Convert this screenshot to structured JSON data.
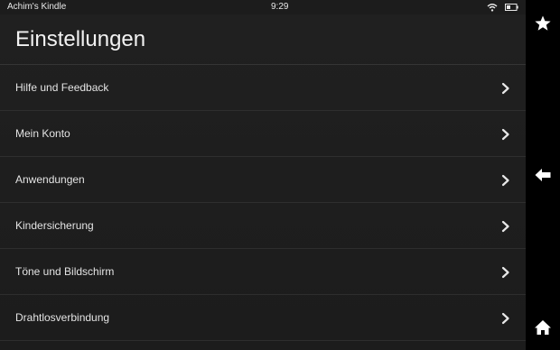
{
  "status_bar": {
    "device_name": "Achim's Kindle",
    "time": "9:29",
    "wifi_icon": "wifi-icon",
    "battery_icon": "battery-icon"
  },
  "page": {
    "title": "Einstellungen"
  },
  "settings": {
    "items": [
      {
        "label": "Hilfe und Feedback",
        "icon": "chevron-right-icon"
      },
      {
        "label": "Mein Konto",
        "icon": "chevron-right-icon"
      },
      {
        "label": "Anwendungen",
        "icon": "chevron-right-icon"
      },
      {
        "label": "Kindersicherung",
        "icon": "chevron-right-icon"
      },
      {
        "label": "Töne und Bildschirm",
        "icon": "chevron-right-icon"
      },
      {
        "label": "Drahtlosverbindung",
        "icon": "chevron-right-icon"
      }
    ]
  },
  "sidebar": {
    "favorites_icon": "star-icon",
    "back_icon": "back-arrow-icon",
    "home_icon": "home-icon"
  },
  "colors": {
    "background": "#000000",
    "panel": "#1e1e1e",
    "text": "#e4e4e4",
    "divider": "#2e2e2e"
  }
}
